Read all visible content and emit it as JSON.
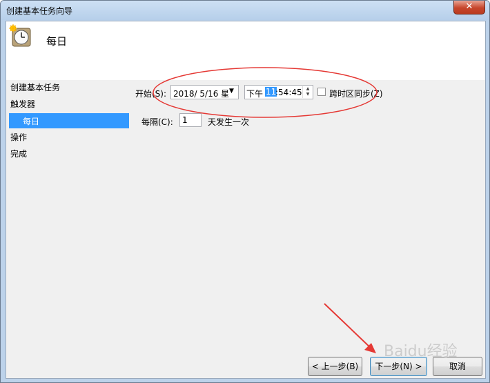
{
  "window": {
    "title": "创建基本任务向导",
    "close_glyph": "✕"
  },
  "header": {
    "title": "每日",
    "icon": "clock-icon"
  },
  "nav": {
    "items": [
      "创建基本任务",
      "触发器",
      "每日",
      "操作",
      "完成"
    ]
  },
  "form": {
    "start_label": "开始(S):",
    "date_value": "2018/  5/16 星",
    "time_ampm": "下午",
    "time_hour": "11",
    "time_rest": ":54:45",
    "sync_label": "跨时区同步(Z)",
    "every_label": "每隔(C):",
    "every_value": "1",
    "every_suffix": "天发生一次"
  },
  "buttons": {
    "back": "< 上一步(B)",
    "next": "下一步(N) >",
    "cancel": "取消"
  },
  "watermark": "Baidu经验",
  "colors": {
    "selection": "#3399ff",
    "annotation": "#e53935"
  }
}
